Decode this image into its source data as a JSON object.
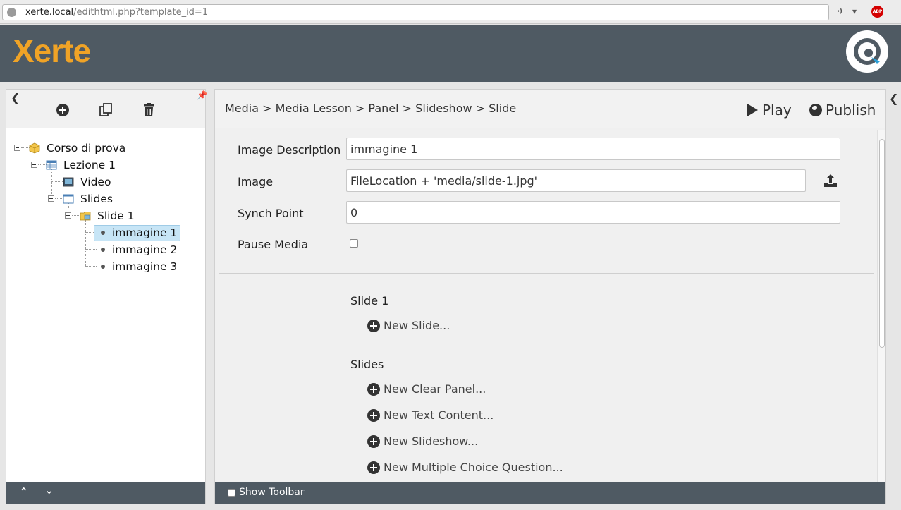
{
  "browser": {
    "url_host": "xerte.local",
    "url_path": "/edithtml.php?template_id=1",
    "abp_label": "ABP"
  },
  "app": {
    "logo_text": "Xerte",
    "accent_color": "#f0a326",
    "header_color": "#4f5a63"
  },
  "left_panel": {
    "toolbar_icons": [
      "plus-circle-icon",
      "copy-icon",
      "trash-icon"
    ],
    "tree": [
      {
        "label": "Corso di prova",
        "icon": "package-icon"
      },
      {
        "label": "Lezione 1",
        "icon": "table-icon"
      },
      {
        "label": "Video",
        "icon": "video-icon"
      },
      {
        "label": "Slides",
        "icon": "window-icon"
      },
      {
        "label": "Slide 1",
        "icon": "folder-image-icon"
      },
      {
        "label": "immagine 1",
        "icon": "bullet-icon",
        "selected": true
      },
      {
        "label": "immagine 2",
        "icon": "bullet-icon"
      },
      {
        "label": "immagine 3",
        "icon": "bullet-icon"
      }
    ],
    "footer_icons": [
      "chevron-up-icon",
      "chevron-down-icon"
    ]
  },
  "main": {
    "breadcrumb": "Media > Media Lesson > Panel > Slideshow > Slide",
    "play_label": "Play",
    "publish_label": "Publish",
    "fields": {
      "image_description": {
        "label": "Image Description",
        "value": "immagine 1"
      },
      "image": {
        "label": "Image",
        "value": "FileLocation + 'media/slide-1.jpg'"
      },
      "synch_point": {
        "label": "Synch Point",
        "value": "0"
      },
      "pause_media": {
        "label": "Pause Media",
        "checked": false
      }
    },
    "sections": [
      {
        "title": "Slide 1",
        "items": [
          "New Slide..."
        ]
      },
      {
        "title": "Slides",
        "items": [
          "New Clear Panel...",
          "New Text Content...",
          "New Slideshow...",
          "New Multiple Choice Question..."
        ]
      }
    ],
    "footer": {
      "show_toolbar_label": "Show Toolbar",
      "checked": false
    }
  }
}
